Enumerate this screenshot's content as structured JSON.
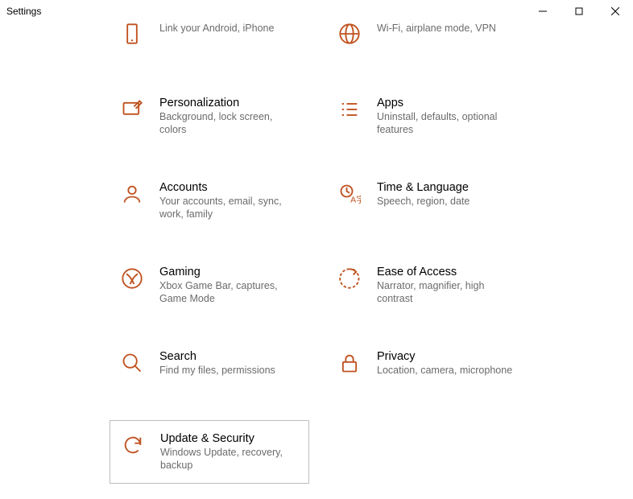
{
  "window": {
    "title": "Settings"
  },
  "tiles": {
    "phone": {
      "title": "",
      "desc": "Link your Android, iPhone"
    },
    "network": {
      "title": "",
      "desc": "Wi-Fi, airplane mode, VPN"
    },
    "personalization": {
      "title": "Personalization",
      "desc": "Background, lock screen, colors"
    },
    "apps": {
      "title": "Apps",
      "desc": "Uninstall, defaults, optional features"
    },
    "accounts": {
      "title": "Accounts",
      "desc": "Your accounts, email, sync, work, family"
    },
    "time": {
      "title": "Time & Language",
      "desc": "Speech, region, date"
    },
    "gaming": {
      "title": "Gaming",
      "desc": "Xbox Game Bar, captures, Game Mode"
    },
    "ease": {
      "title": "Ease of Access",
      "desc": "Narrator, magnifier, high contrast"
    },
    "search": {
      "title": "Search",
      "desc": "Find my files, permissions"
    },
    "privacy": {
      "title": "Privacy",
      "desc": "Location, camera, microphone"
    },
    "update": {
      "title": "Update & Security",
      "desc": "Windows Update, recovery, backup"
    }
  },
  "accent": "#c0521f"
}
